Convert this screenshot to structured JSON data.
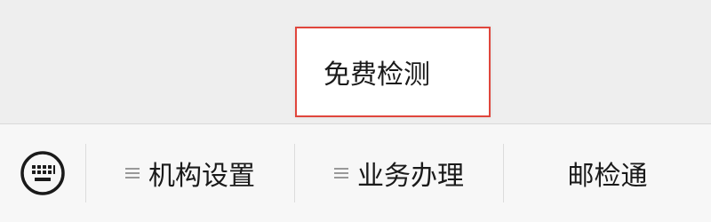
{
  "popup_menu": {
    "items": [
      {
        "label": "免费检测"
      }
    ]
  },
  "menubar": {
    "keyboard_icon": "keyboard-icon",
    "menu_icon": "menu-lines-icon",
    "items": [
      {
        "label": "机构设置",
        "has_submenu": true
      },
      {
        "label": "业务办理",
        "has_submenu": true
      },
      {
        "label": "邮检通",
        "has_submenu": false
      }
    ]
  },
  "colors": {
    "highlight_border": "#e0463c",
    "menubar_bg": "#f7f7f7",
    "page_bg": "#eeeeee"
  }
}
